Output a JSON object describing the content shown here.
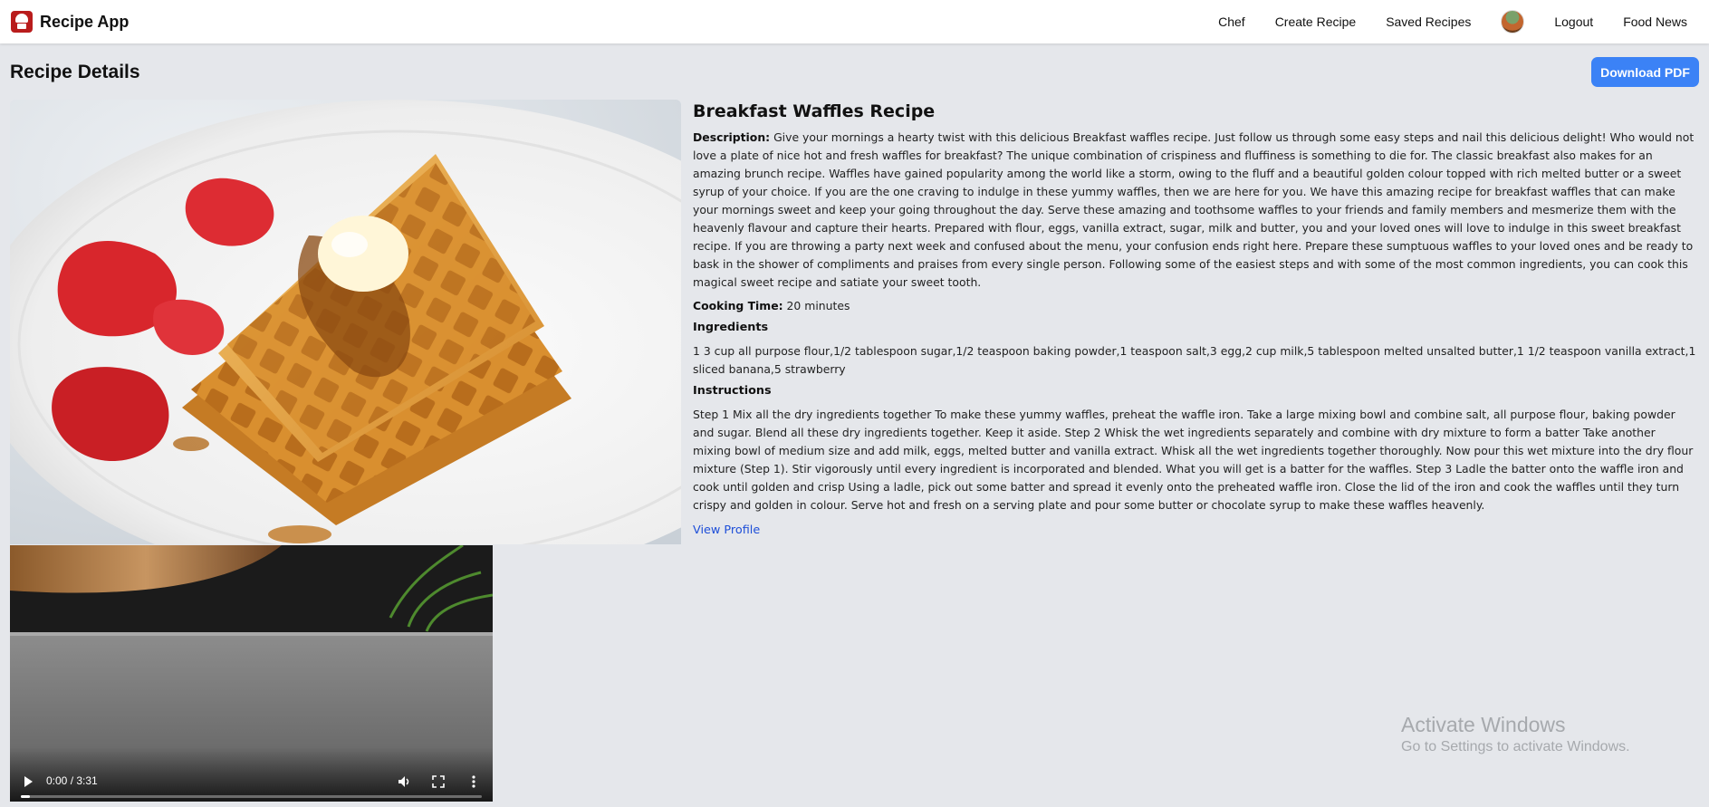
{
  "nav": {
    "brand": "Recipe App",
    "links": {
      "chef": "Chef",
      "create_recipe": "Create Recipe",
      "saved_recipes": "Saved Recipes",
      "logout": "Logout",
      "food_news": "Food News"
    }
  },
  "page": {
    "title": "Recipe Details",
    "download_pdf": "Download PDF"
  },
  "recipe": {
    "title": "Breakfast Waffles Recipe",
    "description_label": "Description:",
    "description": "Give your mornings a hearty twist with this delicious Breakfast waffles recipe. Just follow us through some easy steps and nail this delicious delight! Who would not love a plate of nice hot and fresh waffles for breakfast? The unique combination of crispiness and fluffiness is something to die for. The classic breakfast also makes for an amazing brunch recipe. Waffles have gained popularity among the world like a storm, owing to the fluff and a beautiful golden colour topped with rich melted butter or a sweet syrup of your choice. If you are the one craving to indulge in these yummy waffles, then we are here for you. We have this amazing recipe for breakfast waffles that can make your mornings sweet and keep your going throughout the day. Serve these amazing and toothsome waffles to your friends and family members and mesmerize them with the heavenly flavour and capture their hearts. Prepared with flour, eggs, vanilla extract, sugar, milk and butter, you and your loved ones will love to indulge in this sweet breakfast recipe. If you are throwing a party next week and confused about the menu, your confusion ends right here. Prepare these sumptuous waffles to your loved ones and be ready to bask in the shower of compliments and praises from every single person. Following some of the easiest steps and with some of the most common ingredients, you can cook this magical sweet recipe and satiate your sweet tooth.",
    "cooking_time_label": "Cooking Time:",
    "cooking_time": "20 minutes",
    "ingredients_heading": "Ingredients",
    "ingredients": "1 3 cup all purpose flour,1/2 tablespoon sugar,1/2 teaspoon baking powder,1 teaspoon salt,3 egg,2 cup milk,5 tablespoon melted unsalted butter,1 1/2 teaspoon vanilla extract,1 sliced banana,5 strawberry",
    "instructions_heading": "Instructions",
    "instructions": "Step 1 Mix all the dry ingredients together To make these yummy waffles, preheat the waffle iron. Take a large mixing bowl and combine salt, all purpose flour, baking powder and sugar. Blend all these dry ingredients together. Keep it aside. Step 2 Whisk the wet ingredients separately and combine with dry mixture to form a batter Take another mixing bowl of medium size and add milk, eggs, melted butter and vanilla extract. Whisk all the wet ingredients together thoroughly. Now pour this wet mixture into the dry flour mixture (Step 1). Stir vigorously until every ingredient is incorporated and blended. What you will get is a batter for the waffles. Step 3 Ladle the batter onto the waffle iron and cook until golden and crisp Using a ladle, pick out some batter and spread it evenly onto the preheated waffle iron. Close the lid of the iron and cook the waffles until they turn crispy and golden in colour. Serve hot and fresh on a serving plate and pour some butter or chocolate syrup to make these waffles heavenly.",
    "view_profile": "View Profile"
  },
  "video": {
    "time": "0:00 / 3:31",
    "progress": 0.0
  },
  "watermark": {
    "title": "Activate Windows",
    "subtitle": "Go to Settings to activate Windows."
  },
  "icons": {
    "brand": "chef-hat-icon",
    "play": "play-icon",
    "volume": "volume-icon",
    "fullscreen": "fullscreen-icon",
    "more": "more-vertical-icon"
  },
  "colors": {
    "accent": "#3b82f6",
    "link": "#1d4ed8",
    "background": "#e5e7eb"
  }
}
